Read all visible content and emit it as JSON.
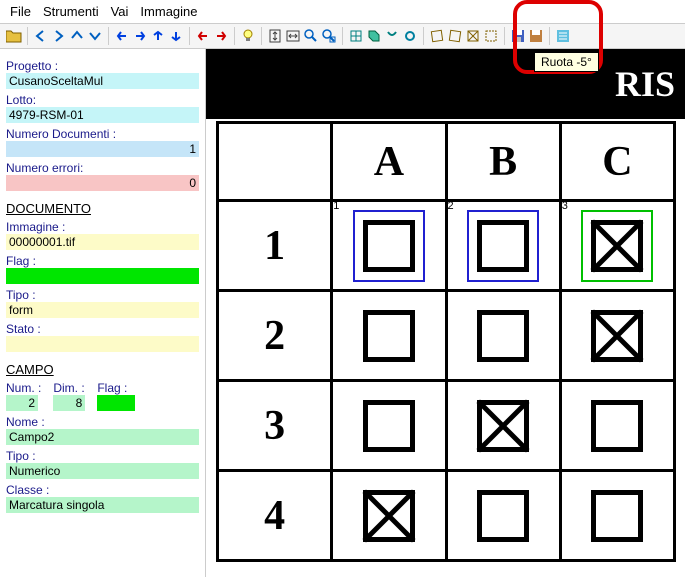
{
  "menu": {
    "file": "File",
    "strumenti": "Strumenti",
    "vai": "Vai",
    "immagine": "Immagine"
  },
  "tooltip": "Ruota -5°",
  "sidebar": {
    "progetto_lbl": "Progetto :",
    "progetto_val": "CusanoSceltaMul",
    "lotto_lbl": "Lotto:",
    "lotto_val": "4979-RSM-01",
    "numdoc_lbl": "Numero Documenti :",
    "numdoc_val": "1",
    "numerr_lbl": "Numero errori:",
    "numerr_val": "0",
    "documento_hdr": "DOCUMENTO",
    "immagine_lbl": "Immagine :",
    "immagine_val": "00000001.tif",
    "flag_lbl": "Flag :",
    "tipo_lbl": "Tipo :",
    "tipo_val": "form",
    "stato_lbl": "Stato :",
    "campo_hdr": "CAMPO",
    "num_lbl": "Num. :",
    "num_val": "2",
    "dim_lbl": "Dim. :",
    "dim_val": "8",
    "cflag_lbl": "Flag :",
    "nome_lbl": "Nome :",
    "nome_val": "Campo2",
    "ctipo_lbl": "Tipo :",
    "ctipo_val": "Numerico",
    "classe_lbl": "Classe :",
    "classe_val": "Marcatura singola"
  },
  "form": {
    "title": "RIS",
    "cols": [
      "A",
      "B",
      "C"
    ],
    "rows": [
      "1",
      "2",
      "3",
      "4"
    ],
    "tags": [
      "1",
      "2",
      "3"
    ]
  }
}
